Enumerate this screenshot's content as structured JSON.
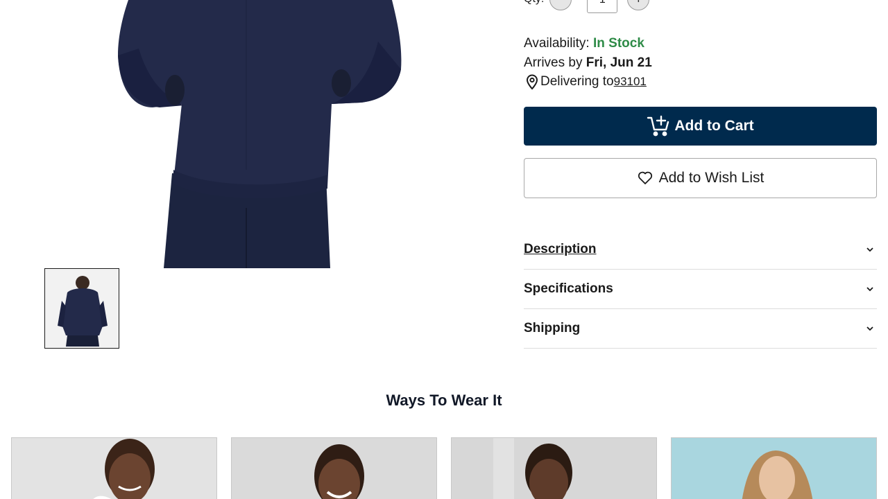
{
  "product": {
    "image_alt": "Men's navy hoodie back view",
    "thumbnail_alt": "Thumbnail back view"
  },
  "quantity": {
    "label": "Qty:",
    "value": "1",
    "minus": "−",
    "plus": "+"
  },
  "availability": {
    "label": "Availability:",
    "status": "In Stock",
    "status_color": "#2e8b47"
  },
  "arrival": {
    "label": "Arrives by",
    "date": "Fri, Jun 21"
  },
  "delivery": {
    "label": "Delivering to",
    "zip": "93101",
    "icon": "location-pin-icon"
  },
  "actions": {
    "add_to_cart": "Add to Cart",
    "add_to_cart_color": "#002a4d",
    "add_to_wishlist": "Add to Wish List"
  },
  "accordions": [
    {
      "title": "Description"
    },
    {
      "title": "Specifications"
    },
    {
      "title": "Shipping"
    }
  ],
  "ways_to_wear": {
    "title": "Ways To Wear It"
  }
}
